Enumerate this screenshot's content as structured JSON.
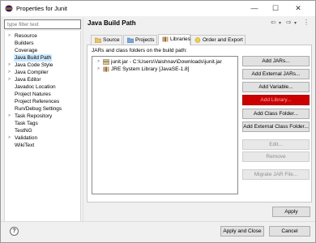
{
  "window": {
    "title": "Properties for Junit",
    "minimize": "—",
    "maximize": "☐",
    "close": "✕"
  },
  "sidebar": {
    "filter_placeholder": "type filter text",
    "items": [
      {
        "label": "Resource",
        "expandable": true,
        "selected": false
      },
      {
        "label": "Builders",
        "expandable": false,
        "selected": false
      },
      {
        "label": "Coverage",
        "expandable": false,
        "selected": false
      },
      {
        "label": "Java Build Path",
        "expandable": false,
        "selected": true
      },
      {
        "label": "Java Code Style",
        "expandable": true,
        "selected": false
      },
      {
        "label": "Java Compiler",
        "expandable": true,
        "selected": false
      },
      {
        "label": "Java Editor",
        "expandable": true,
        "selected": false
      },
      {
        "label": "Javadoc Location",
        "expandable": false,
        "selected": false
      },
      {
        "label": "Project Natures",
        "expandable": false,
        "selected": false
      },
      {
        "label": "Project References",
        "expandable": false,
        "selected": false
      },
      {
        "label": "Run/Debug Settings",
        "expandable": false,
        "selected": false
      },
      {
        "label": "Task Repository",
        "expandable": true,
        "selected": false
      },
      {
        "label": "Task Tags",
        "expandable": false,
        "selected": false
      },
      {
        "label": "TestNG",
        "expandable": false,
        "selected": false
      },
      {
        "label": "Validation",
        "expandable": true,
        "selected": false
      },
      {
        "label": "WikiText",
        "expandable": false,
        "selected": false
      }
    ]
  },
  "header": {
    "title": "Java Build Path",
    "back": "⇦",
    "back_menu": "▾",
    "forward": "⇨",
    "forward_menu": "▾",
    "more": "⋮"
  },
  "tabs": [
    {
      "label": "Source",
      "active": false
    },
    {
      "label": "Projects",
      "active": false
    },
    {
      "label": "Libraries",
      "active": true
    },
    {
      "label": "Order and Export",
      "active": false
    }
  ],
  "libraries": {
    "caption": "JARs and class folders on the build path:",
    "entries": [
      {
        "label": "junit.jar - C:\\Users\\Vaishnav\\Downloads\\junit.jar"
      },
      {
        "label": "JRE System Library [JavaSE-1.8]"
      }
    ]
  },
  "buttons": {
    "add_jars": "Add JARs...",
    "add_external_jars": "Add External JARs...",
    "add_variable": "Add Variable...",
    "add_library": "Add Library...",
    "add_class_folder": "Add Class Folder...",
    "add_external_class_folder": "Add External Class Folder...",
    "edit": "Edit...",
    "remove": "Remove",
    "migrate_jar": "Migrate JAR File...",
    "apply": "Apply"
  },
  "footer": {
    "help": "?",
    "apply_and_close": "Apply and Close",
    "cancel": "Cancel"
  },
  "colors": {
    "selection": "#cce8ff",
    "highlighted_button": "#cc0000"
  }
}
